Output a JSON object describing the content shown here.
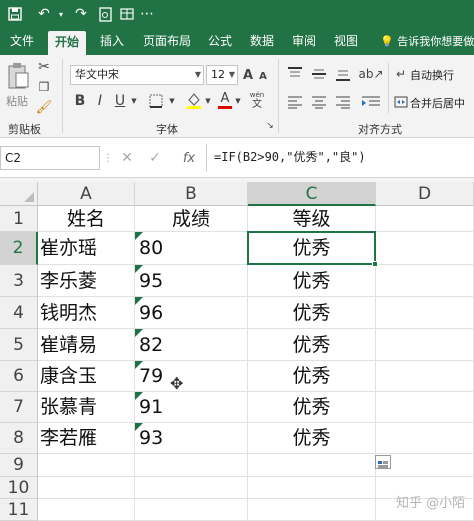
{
  "tabs": [
    "文件",
    "开始",
    "插入",
    "页面布局",
    "公式",
    "数据",
    "审阅",
    "视图"
  ],
  "active_tab": "开始",
  "tell_me": "告诉我你想要做什",
  "ribbon": {
    "paste_label": "粘贴",
    "clipboard_group": "剪贴板",
    "font_group": "字体",
    "alignment_group": "对齐方式",
    "font_name": "华文中宋",
    "font_size": "12",
    "wrap_text": "自动换行",
    "merge_center": "合并后居中",
    "bold": "B",
    "italic": "I",
    "underline": "U",
    "grow_font": "A",
    "shrink_font": "A",
    "font_color_glyph": "A",
    "wen_glyph": "文",
    "wen2_glyph": "wén"
  },
  "formula_bar": {
    "name_box": "C2",
    "fx": "fx",
    "formula": "=IF(B2>90,\"优秀\",\"良\")"
  },
  "columns": [
    "A",
    "B",
    "C",
    "D"
  ],
  "rows": [
    "1",
    "2",
    "3",
    "4",
    "5",
    "6",
    "7",
    "8",
    "9",
    "10",
    "11"
  ],
  "sheet": {
    "headers": [
      "姓名",
      "成绩",
      "等级"
    ],
    "records": [
      {
        "name": "崔亦瑶",
        "score": "80",
        "grade": "优秀"
      },
      {
        "name": "李乐菱",
        "score": "95",
        "grade": "优秀"
      },
      {
        "name": "钱明杰",
        "score": "96",
        "grade": "优秀"
      },
      {
        "name": "崔靖易",
        "score": "82",
        "grade": "优秀"
      },
      {
        "name": "康含玉",
        "score": "79",
        "grade": "优秀"
      },
      {
        "name": "张慕青",
        "score": "91",
        "grade": "优秀"
      },
      {
        "name": "李若雁",
        "score": "93",
        "grade": "优秀"
      }
    ]
  },
  "selected_cell": "C2",
  "watermark": "知乎 @小陌",
  "colors": {
    "accent": "#217346",
    "number_flag": "#1e7145"
  }
}
